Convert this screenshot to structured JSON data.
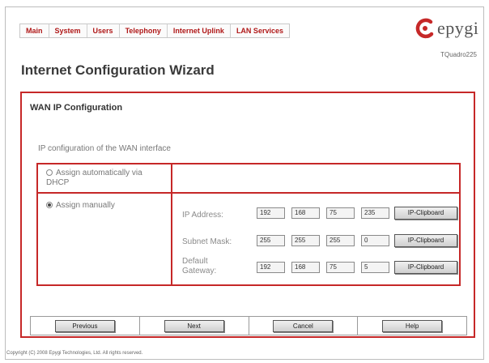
{
  "nav": {
    "items": [
      {
        "label": "Main"
      },
      {
        "label": "System"
      },
      {
        "label": "Users"
      },
      {
        "label": "Telephony"
      },
      {
        "label": "Internet Uplink"
      },
      {
        "label": "LAN Services"
      }
    ]
  },
  "brand": {
    "logo_text": "epygi",
    "model": "TQuadro225",
    "color": "#c62828"
  },
  "page": {
    "title": "Internet Configuration Wizard"
  },
  "wan": {
    "title": "WAN IP Configuration",
    "section_label": "IP configuration of the WAN interface",
    "option_auto": {
      "line1": "Assign automatically via",
      "line2": "DHCP",
      "selected": false
    },
    "option_manual": {
      "label": "Assign manually",
      "selected": true
    },
    "ip_address": {
      "label": "IP Address:",
      "octets": [
        "192",
        "168",
        "75",
        "235"
      ]
    },
    "subnet_mask": {
      "label": "Subnet Mask:",
      "octets": [
        "255",
        "255",
        "255",
        "0"
      ]
    },
    "gateway": {
      "label_line1": "Default",
      "label_line2": "Gateway:",
      "octets": [
        "192",
        "168",
        "75",
        "5"
      ]
    },
    "clipboard_label": "IP-Clipboard"
  },
  "buttons": {
    "previous": "Previous",
    "next": "Next",
    "cancel": "Cancel",
    "help": "Help"
  },
  "footer": {
    "copyright": "Copyright (C) 2008 Epygi Technologies, Ltd. All rights reserved."
  }
}
